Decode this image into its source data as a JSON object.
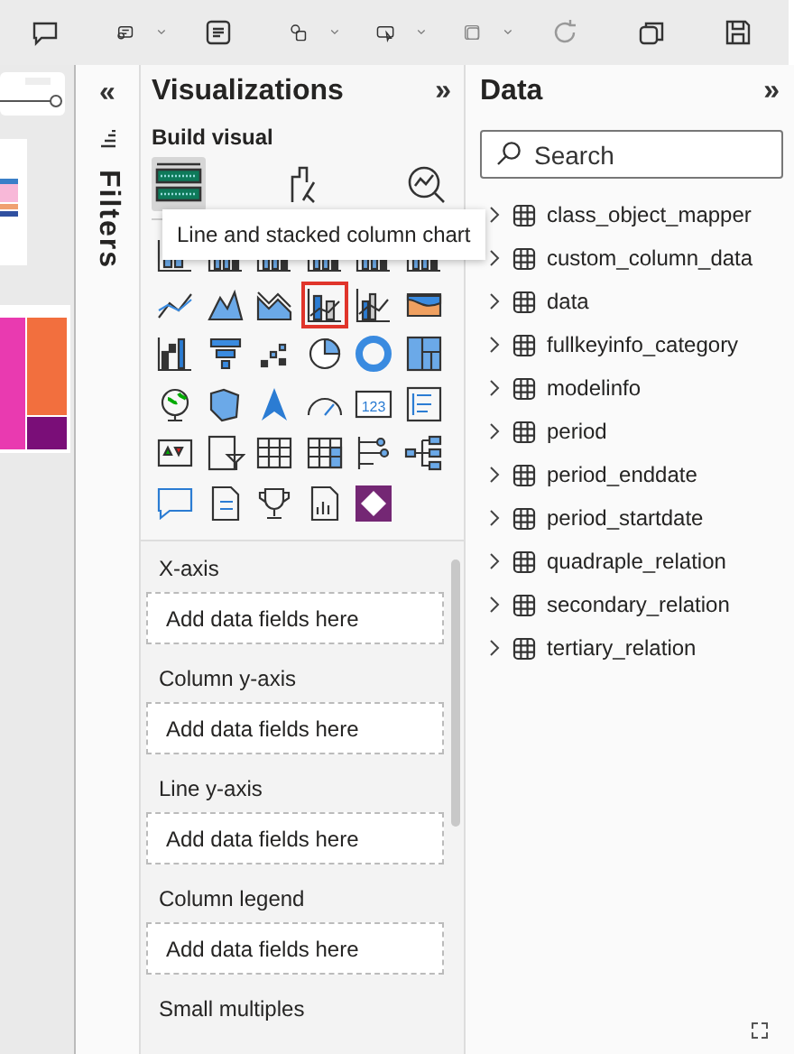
{
  "visualizations": {
    "title": "Visualizations",
    "collapse": "»",
    "build_visual_label": "Build visual",
    "modes": [
      {
        "selected": true
      },
      {
        "selected": false
      },
      {
        "selected": false
      }
    ],
    "tooltip": "Line and stacked column chart",
    "visuals": [
      {
        "selected": false
      },
      {
        "selected": false
      },
      {
        "selected": false
      },
      {
        "selected": false
      },
      {
        "selected": false
      },
      {
        "selected": false
      },
      {
        "selected": false
      },
      {
        "selected": false
      },
      {
        "selected": false
      },
      {
        "selected": true
      },
      {
        "selected": false
      },
      {
        "selected": false
      },
      {
        "selected": false
      },
      {
        "selected": false
      },
      {
        "selected": false
      },
      {
        "selected": false
      },
      {
        "selected": false
      },
      {
        "selected": false
      },
      {
        "selected": false
      },
      {
        "selected": false
      },
      {
        "selected": false
      },
      {
        "selected": false
      },
      {
        "selected": false,
        "glyph": "123"
      },
      {
        "selected": false
      },
      {
        "selected": false
      },
      {
        "selected": false
      },
      {
        "selected": false
      },
      {
        "selected": false
      },
      {
        "selected": false
      },
      {
        "selected": false
      },
      {
        "selected": false
      },
      {
        "selected": false
      },
      {
        "selected": false
      },
      {
        "selected": false
      },
      {
        "selected": false
      }
    ],
    "wells": [
      {
        "label": "X-axis",
        "placeholder": "Add data fields here"
      },
      {
        "label": "Column y-axis",
        "placeholder": "Add data fields here"
      },
      {
        "label": "Line y-axis",
        "placeholder": "Add data fields here"
      },
      {
        "label": "Column legend",
        "placeholder": "Add data fields here"
      },
      {
        "label": "Small multiples"
      }
    ]
  },
  "filters": {
    "collapse": "«",
    "title": "Filters"
  },
  "data": {
    "title": "Data",
    "collapse": "»",
    "search": {
      "placeholder": "Search"
    },
    "tables": [
      {
        "name": "class_object_mapper",
        "expanded": false
      },
      {
        "name": "custom_column_data",
        "expanded": false
      },
      {
        "name": "data",
        "expanded": false
      },
      {
        "name": "fullkeyinfo_category",
        "expanded": false
      },
      {
        "name": "modelinfo",
        "expanded": false
      },
      {
        "name": "period",
        "expanded": false
      },
      {
        "name": "period_enddate",
        "expanded": false
      },
      {
        "name": "period_startdate",
        "expanded": false
      },
      {
        "name": "quadraple_relation",
        "expanded": false
      },
      {
        "name": "secondary_relation",
        "expanded": false
      },
      {
        "name": "tertiary_relation",
        "expanded": false
      }
    ]
  }
}
